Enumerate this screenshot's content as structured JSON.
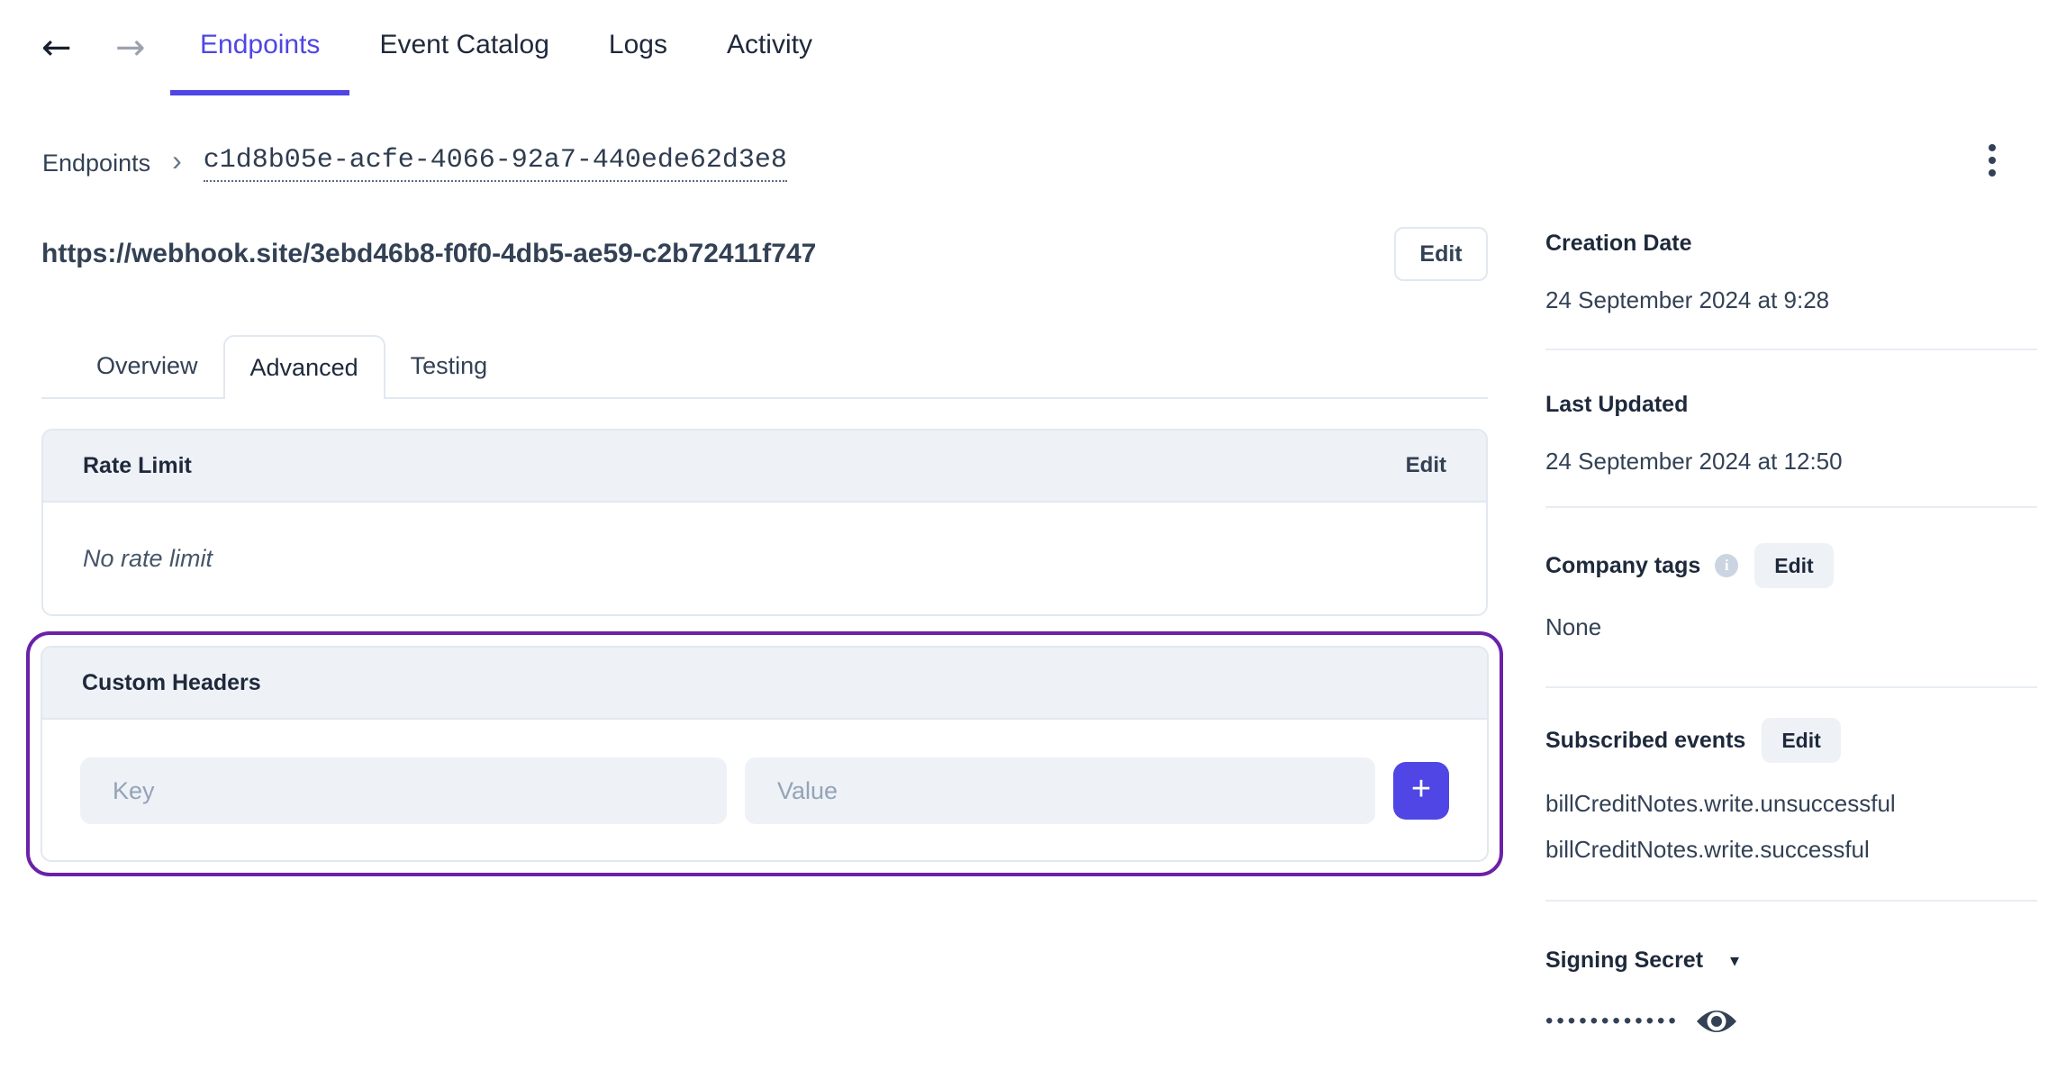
{
  "nav": {
    "back_glyph": "←",
    "forward_glyph": "→",
    "tabs": [
      {
        "label": "Endpoints",
        "active": true
      },
      {
        "label": "Event Catalog",
        "active": false
      },
      {
        "label": "Logs",
        "active": false
      },
      {
        "label": "Activity",
        "active": false
      }
    ]
  },
  "breadcrumb": {
    "root": "Endpoints",
    "separator": "›",
    "current_id": "c1d8b05e-acfe-4066-92a7-440ede62d3e8"
  },
  "endpoint": {
    "url": "https://webhook.site/3ebd46b8-f0f0-4db5-ae59-c2b72411f747",
    "edit_label": "Edit",
    "tabs": [
      {
        "label": "Overview",
        "active": false
      },
      {
        "label": "Advanced",
        "active": true
      },
      {
        "label": "Testing",
        "active": false
      }
    ]
  },
  "rate_limit": {
    "title": "Rate Limit",
    "edit_label": "Edit",
    "empty_text": "No rate limit"
  },
  "custom_headers": {
    "title": "Custom Headers",
    "key_placeholder": "Key",
    "value_placeholder": "Value",
    "add_glyph": "+"
  },
  "sidebar": {
    "creation_date": {
      "label": "Creation Date",
      "value": "24 September 2024 at 9:28"
    },
    "last_updated": {
      "label": "Last Updated",
      "value": "24 September 2024 at 12:50"
    },
    "company_tags": {
      "label": "Company tags",
      "info_glyph": "i",
      "edit_label": "Edit",
      "value": "None"
    },
    "subscribed_events": {
      "label": "Subscribed events",
      "edit_label": "Edit",
      "events": [
        "billCreditNotes.write.unsuccessful",
        "billCreditNotes.write.successful"
      ]
    },
    "signing_secret": {
      "label": "Signing Secret",
      "caret_glyph": "▾",
      "masked_value": "••••••••••••"
    }
  },
  "colors": {
    "accent": "#4f46e5",
    "highlight_ring": "#6b21a8",
    "panel_header_bg": "#eef1f6",
    "border": "#e2e8f0",
    "text_dark": "#1e293b",
    "text_body": "#334155",
    "placeholder": "#94a3b8"
  }
}
